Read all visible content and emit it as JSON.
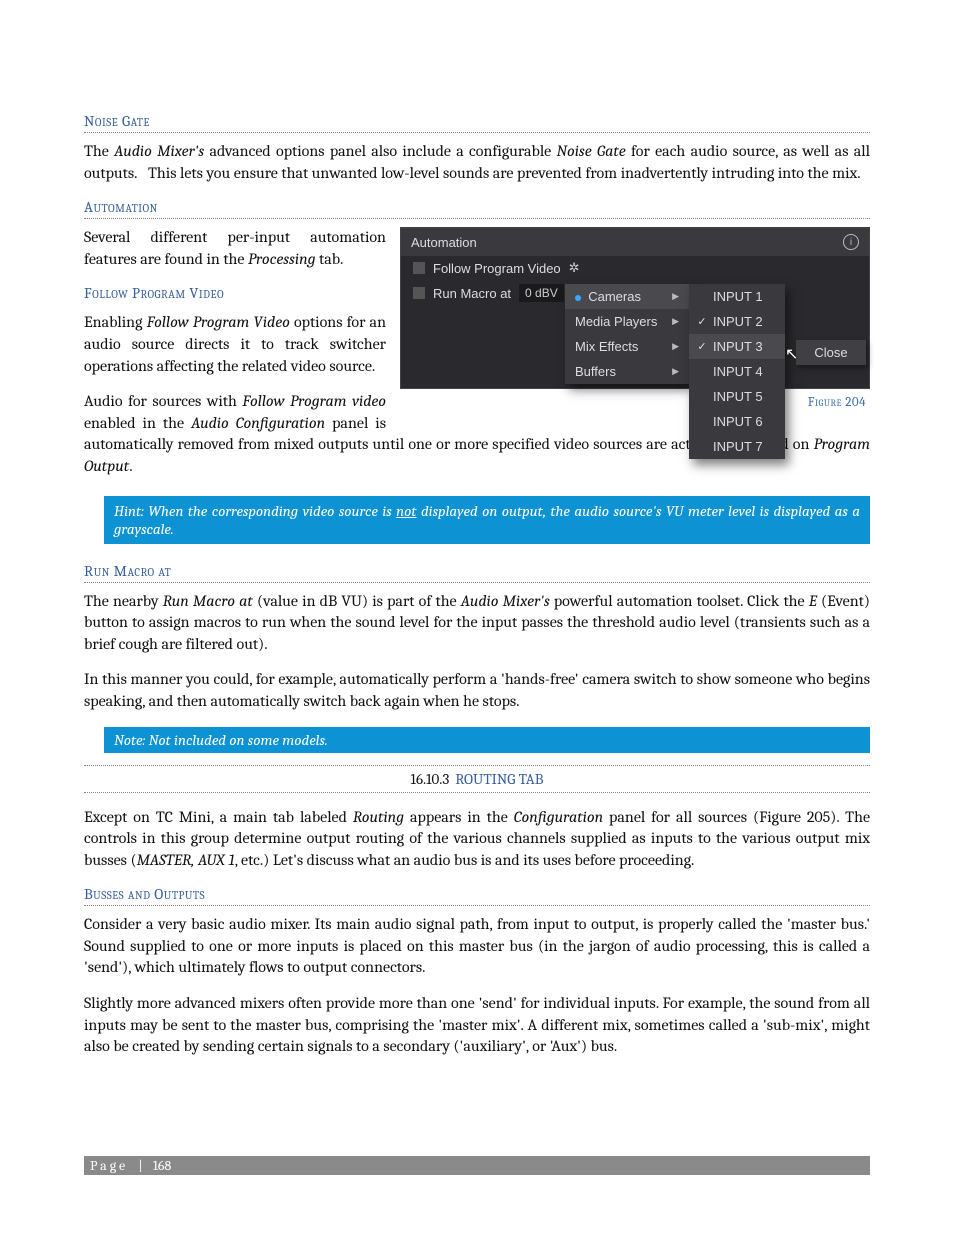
{
  "headings": {
    "noise_gate": "Noise Gate",
    "automation": "Automation",
    "follow_pv": "Follow Program Video",
    "run_macro": "Run Macro at",
    "busses": "Busses and Outputs"
  },
  "paragraphs": {
    "noise_gate": "The Audio Mixer's advanced options panel also include a configurable Noise Gate for each audio source, as well as all outputs.   This lets you ensure that unwanted low-level sounds are prevented from inadvertently intruding into the mix.",
    "automation_intro": "Several different per-input automation features are found in the Processing tab.",
    "follow_pv": "Enabling Follow Program Video options for an audio source directs it to track switcher operations affecting the related video source.",
    "follow_pv2": "Audio for sources with Follow Program video enabled in the Audio Configuration panel is automatically removed from mixed outputs until one or more specified video sources are actually displayed on Program Output.",
    "hint_pre": "Hint: When the corresponding video source is ",
    "hint_not": "not",
    "hint_post": " displayed on output, the audio source's VU meter level is displayed as a grayscale.",
    "run_macro_p1": "The nearby Run Macro at (value in dB VU) is part of the Audio Mixer's powerful automation toolset.  Click the E (Event) button to assign macros to run when the sound level for the input passes the threshold audio level (transients such as a brief cough are filtered out).",
    "run_macro_p2": "In this manner you could, for example, automatically perform a 'hands-free' camera switch to show someone who begins speaking, and then automatically switch back again when he stops.",
    "note": "Note: Not included on some models.",
    "routing_p": "Except on TC Mini, a main tab labeled Routing appears in the Configuration panel for all sources (Figure 205).  The controls in this group determine output routing of the various channels supplied as inputs to the various output mix busses (MASTER, AUX 1, etc.)  Let's discuss what an audio bus is and its uses before proceeding.",
    "busses_p1": "Consider a very basic audio mixer.  Its main audio signal path, from input to output, is properly called the 'master bus.'  Sound supplied to one or more inputs is placed on this master bus (in the jargon of audio processing, this is called a 'send'), which ultimately flows to output connectors.",
    "busses_p2": "Slightly more advanced mixers often provide more than one 'send' for individual inputs.  For example, the sound from all inputs may be sent to the master bus, comprising the 'master mix'.  A different mix, sometimes called a 'sub-mix', might also be created by sending certain signals to a secondary ('auxiliary', or 'Aux') bus."
  },
  "section": {
    "num": "16.10.3",
    "title": "ROUTING TAB"
  },
  "figure": {
    "caption": "Figure 204",
    "panel_title": "Automation",
    "follow_label": "Follow Program Video",
    "run_label": "Run Macro at",
    "run_value": "0 dBV",
    "menu1": [
      "Cameras",
      "Media Players",
      "Mix Effects",
      "Buffers"
    ],
    "menu1_selected": 0,
    "menu2": [
      {
        "label": "INPUT 1",
        "checked": false
      },
      {
        "label": "INPUT 2",
        "checked": true
      },
      {
        "label": "INPUT 3",
        "checked": true
      },
      {
        "label": "INPUT 4",
        "checked": false
      },
      {
        "label": "INPUT 5",
        "checked": false
      },
      {
        "label": "INPUT 6",
        "checked": false
      },
      {
        "label": "INPUT 7",
        "checked": false
      }
    ],
    "menu2_highlight": 2,
    "close": "Close"
  },
  "footer": {
    "label": "Page",
    "sep": "|",
    "num": "168"
  }
}
